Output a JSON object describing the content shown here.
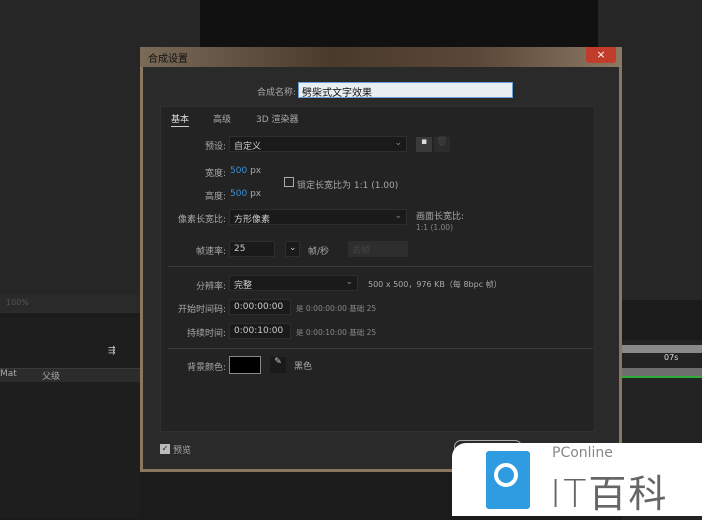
{
  "background": {
    "zoom": "100%",
    "timeline_col_mat": "Mat",
    "timeline_col_parent": "父级",
    "ruler_time": "07s"
  },
  "dialog": {
    "title": "合成设置",
    "close": "×",
    "name_label": "合成名称:",
    "name_value": "劈柴式文字效果",
    "tabs": [
      "基本",
      "高级",
      "3D 渲染器"
    ],
    "preset_label": "预设:",
    "preset_value": "自定义",
    "width_label": "宽度:",
    "width_value": "500",
    "height_label": "高度:",
    "height_value": "500",
    "unit": "px",
    "lock_label": "锁定长宽比为 1:1 (1.00)",
    "lock_checked": false,
    "par_label": "像素长宽比:",
    "par_value": "方形像素",
    "frame_aspect_label": "画面长宽比:",
    "frame_aspect_value": "1:1 (1.00)",
    "fps_label": "帧速率:",
    "fps_value": "25",
    "fps_unit": "帧/秒",
    "drop_frame": "丢帧",
    "res_label": "分辨率:",
    "res_value": "完整",
    "res_info": "500 x 500，976 KB（每 8bpc 帧）",
    "start_label": "开始时间码:",
    "start_value": "0:00:00:00",
    "start_info": "是 0:00:00:00  基础 25",
    "dur_label": "持续时间:",
    "dur_value": "0:00:10:00",
    "dur_info": "是 0:00:10:00  基础 25",
    "bg_label": "背景颜色:",
    "bg_color": "#000000",
    "bg_name": "黑色",
    "preview_label": "预览",
    "preview_checked": true
  },
  "watermark": {
    "brand": "PConline",
    "name": "IT百科",
    "color": "#2f9be0"
  }
}
